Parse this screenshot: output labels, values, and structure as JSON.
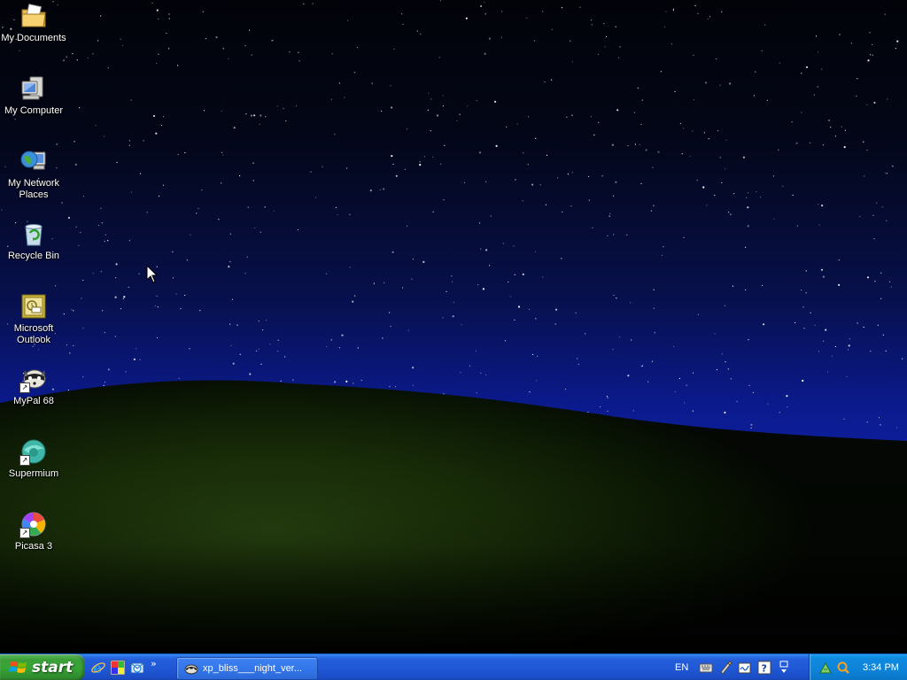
{
  "desktop": {
    "icons": [
      {
        "label": "My Documents",
        "icon": "my-documents-icon"
      },
      {
        "label": "My Computer",
        "icon": "my-computer-icon"
      },
      {
        "label": "My Network Places",
        "icon": "network-places-icon"
      },
      {
        "label": "Recycle Bin",
        "icon": "recycle-bin-icon"
      },
      {
        "label": "Microsoft Outlook",
        "icon": "outlook-icon"
      },
      {
        "label": "MyPal 68",
        "icon": "mypal-icon"
      },
      {
        "label": "Supermium",
        "icon": "supermium-icon"
      },
      {
        "label": "Picasa 3",
        "icon": "picasa-icon"
      }
    ]
  },
  "taskbar": {
    "start_label": "start",
    "quick_launch": [
      "internet-explorer-icon",
      "paint-icon",
      "outlook-express-icon"
    ],
    "quick_launch_more": "»",
    "tasks": [
      {
        "label": "xp_bliss___night_ver...",
        "icon": "image-viewer-icon"
      }
    ],
    "language": "EN",
    "clock": "3:34 PM"
  },
  "colors": {
    "taskbar_blue": "#245edb",
    "start_green": "#37a535",
    "tray_blue": "#0f8ae0"
  }
}
